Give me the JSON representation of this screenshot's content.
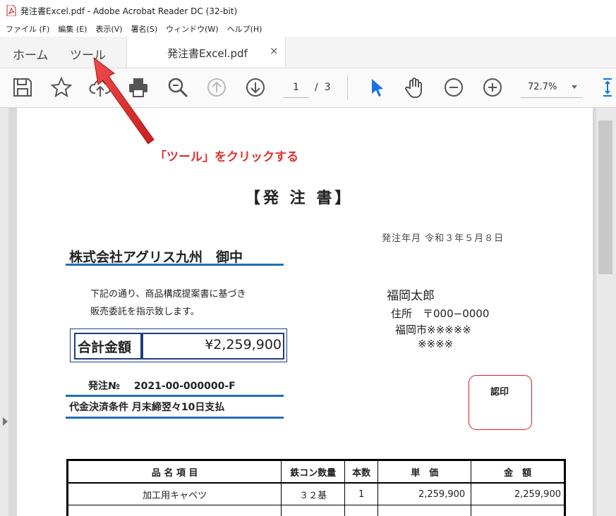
{
  "window": {
    "title": "発注書Excel.pdf - Adobe Acrobat Reader DC (32-bit)"
  },
  "menu": [
    "ファイル (F)",
    "編集 (E)",
    "表示(V)",
    "署名(S)",
    "ウィンドウ(W)",
    "ヘルプ(H)"
  ],
  "tabs": {
    "home": "ホーム",
    "tools": "ツール",
    "doc_name": "発注書Excel.pdf",
    "close": "×"
  },
  "toolbar": {
    "page_current": "1",
    "page_sep": "/",
    "page_total": "3",
    "zoom": "72.7%"
  },
  "annotation": {
    "text": "「ツール」をクリックする",
    "color": "#e53935"
  },
  "document": {
    "title": "【発 注 書】",
    "issue_date": "発注年月 令和３年５月８日",
    "recipient": "株式会社アグリス九州　御中",
    "note1": "下記の通り、商品構成提案書に基づき",
    "note2": "販売委託を指示致します。",
    "total_label": "合計金額",
    "total_amount": "¥2,259,900",
    "sender_name": "福岡太郎",
    "sender_addr1": "住所　〒000−0000",
    "sender_addr2": "福岡市※※※※※",
    "sender_addr3": "※※※※",
    "order_no_label": "発注№",
    "order_no_value": "2021-00-000000-F",
    "payment": "代金決済条件 月末締翌々10日支払",
    "stamp": "認印",
    "table": {
      "headers": [
        "品 名 項 目",
        "鉄コン数量",
        "本数",
        "単　価",
        "金　額"
      ],
      "rows": [
        [
          "加工用キャベツ",
          "３２基",
          "1",
          "2,259,900",
          "2,259,900"
        ]
      ]
    }
  },
  "colors": {
    "accent_blue": "#1f6fb8",
    "acrobat_blue": "#1473e6",
    "stamp_red": "#d92020"
  }
}
